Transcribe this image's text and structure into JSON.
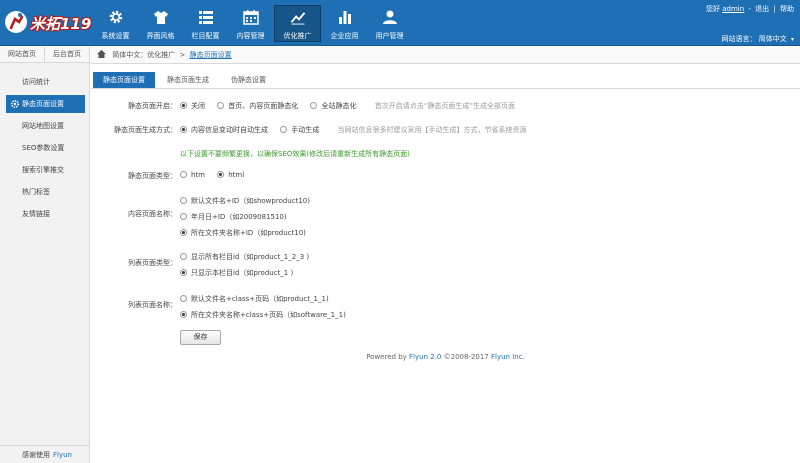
{
  "app": {
    "logo_text": "米拓119"
  },
  "nav": [
    {
      "label": "系统设置",
      "icon": "gear-icon"
    },
    {
      "label": "界面风格",
      "icon": "shirt-icon"
    },
    {
      "label": "栏目配置",
      "icon": "list-icon"
    },
    {
      "label": "内容管理",
      "icon": "calendar-icon"
    },
    {
      "label": "优化推广",
      "icon": "trend-icon",
      "active": true
    },
    {
      "label": "企业应用",
      "icon": "bar-chart-icon"
    },
    {
      "label": "用户管理",
      "icon": "user-icon"
    }
  ],
  "top_right": {
    "greeting": "您好",
    "user": "admin",
    "logout": "退出",
    "help": "帮助",
    "lang_label": "网站语言：",
    "lang_value": "简体中文"
  },
  "sidebar": {
    "tabs": [
      "网站首页",
      "后台首页"
    ],
    "items": [
      {
        "label": "访问统计"
      },
      {
        "label": "静态页面设置",
        "active": true
      },
      {
        "label": "网站地图设置"
      },
      {
        "label": "SEO参数设置"
      },
      {
        "label": "搜索引擎推交"
      },
      {
        "label": "热门标签"
      },
      {
        "label": "友情链接"
      }
    ],
    "footer_text": "感谢使用",
    "footer_link": "Flyun"
  },
  "breadcrumb": {
    "prefix": "简体中文：优化推广",
    "sep": ">",
    "current": "静态页面设置"
  },
  "tabs": [
    "静态页面设置",
    "静态页面生成",
    "伪静态设置"
  ],
  "form": {
    "static_open": {
      "label": "静态页面开启：",
      "options": [
        "关闭",
        "首页、内容页面静态化",
        "全站静态化"
      ],
      "selected": 0,
      "hint": "首次开启请点击“静态页面生成”生成全部页面"
    },
    "gen_mode": {
      "label": "静态页面生成方式：",
      "options": [
        "内容信息变动时自动生成",
        "手动生成"
      ],
      "selected": 0,
      "hint": "当网站信息很多时建议采用【手动生成】方式，节省系统资源"
    },
    "note": "以下设置不要频繁更换，以确保SEO效果(修改后请重新生成所有静态页面)",
    "page_type": {
      "label": "静态页面类型：",
      "options": [
        "htm",
        "html"
      ],
      "selected": 1
    },
    "content_name": {
      "label": "内容页面名称：",
      "options": [
        "默认文件名+ID（如showproduct10)",
        "年月日+ID（如2009081510)",
        "所在文件夹名称+ID（如product10)"
      ],
      "selected": 2
    },
    "list_type": {
      "label": "列表页面类型：",
      "options": [
        "显示所有栏目id（如product_1_2_3 )",
        "只显示本栏目id（如product_1 )"
      ],
      "selected": 1
    },
    "list_name": {
      "label": "列表页面名称：",
      "options": [
        "默认文件名+class+页码（如product_1_1)",
        "所在文件夹名称+class+页码（如software_1_1)"
      ],
      "selected": 1
    },
    "save_label": "保存"
  },
  "footer": {
    "prefix": "Powered by",
    "product": "Flyun 2.0",
    "years": "©2008-2017",
    "company": "Flyun Inc."
  },
  "colors": {
    "primary": "#1f6fb5",
    "note": "#3a9b2c"
  }
}
